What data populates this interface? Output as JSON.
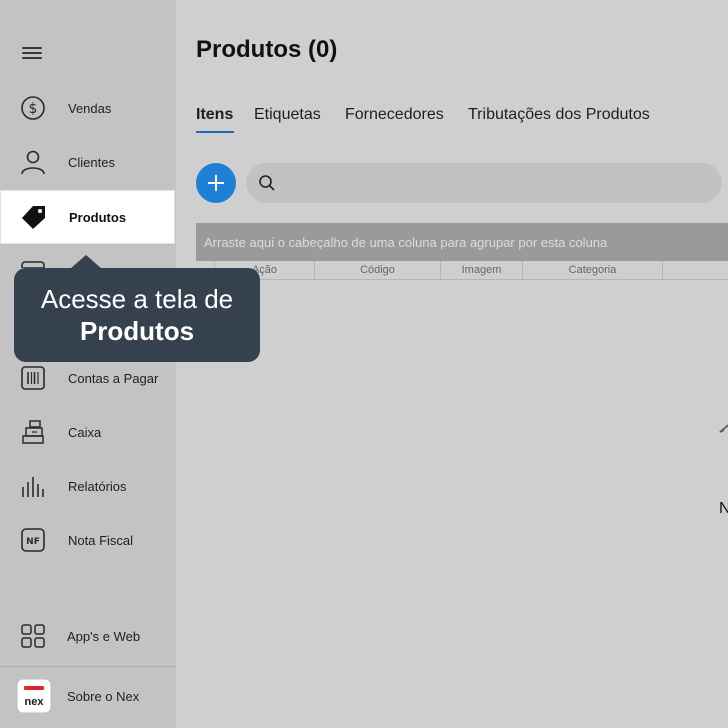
{
  "sidebar": {
    "items": [
      {
        "label": "Vendas",
        "icon": "dollar-circle-icon"
      },
      {
        "label": "Clientes",
        "icon": "user-icon"
      },
      {
        "label": "Produtos",
        "icon": "tag-icon",
        "active": true
      },
      {
        "label": "",
        "icon": "box-icon"
      },
      {
        "label": "",
        "icon": "hidden-item-icon"
      },
      {
        "label": "Contas a Pagar",
        "icon": "barcode-icon"
      },
      {
        "label": "Caixa",
        "icon": "cash-register-icon"
      },
      {
        "label": "Relatórios",
        "icon": "bar-chart-icon"
      },
      {
        "label": "Nota Fiscal",
        "icon": "nf-icon"
      }
    ],
    "apps_label": "App's e Web",
    "about_label": "Sobre o Nex",
    "about_logo_text": "nex"
  },
  "main": {
    "title": "Produtos (0)",
    "tabs": [
      {
        "label": "Itens",
        "active": true
      },
      {
        "label": "Etiquetas"
      },
      {
        "label": "Fornecedores"
      },
      {
        "label": "Tributações dos Produtos"
      }
    ],
    "search_placeholder": "",
    "group_hint": "Arraste aqui o cabeçalho de uma coluna para agrupar por esta coluna",
    "columns": [
      "Ação",
      "Código",
      "Imagem",
      "Categoria"
    ],
    "empty_text": "N"
  },
  "tooltip": {
    "line1": "Acesse a tela de",
    "line2": "Produtos"
  },
  "colors": {
    "accent": "#1f7fd6",
    "tooltip_bg": "#364150",
    "sidebar_bg": "#c3c3c3",
    "main_bg": "#cfcfcf",
    "logo_red": "#d8282f"
  }
}
